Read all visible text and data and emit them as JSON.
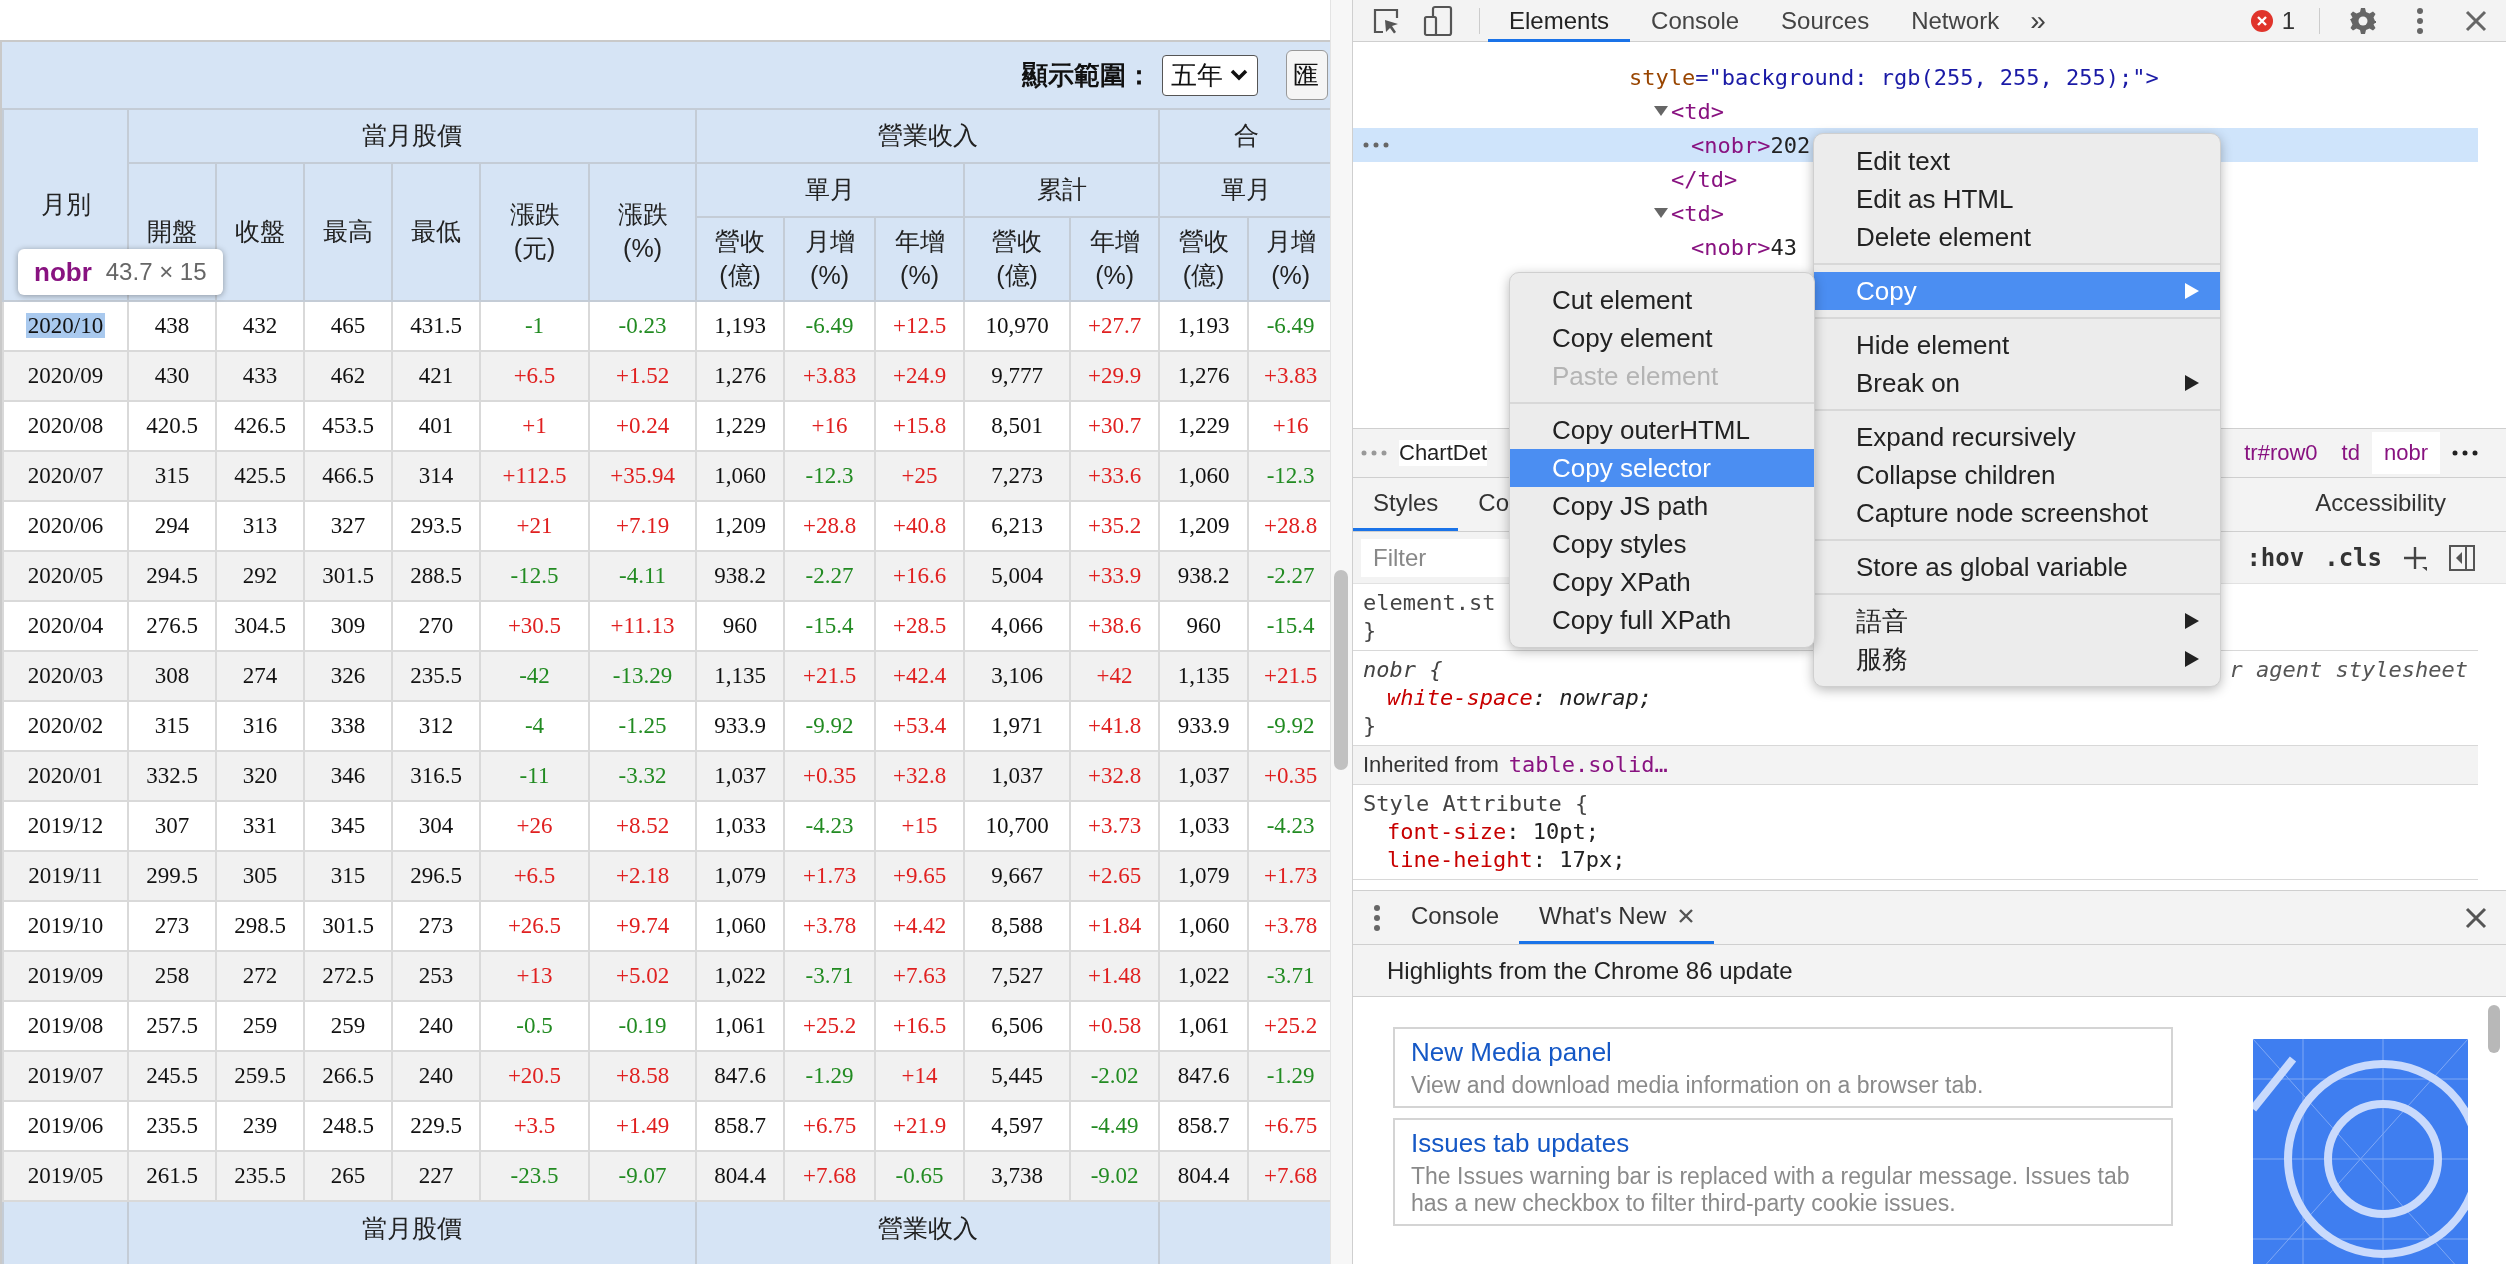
{
  "page": {
    "range_label": "顯示範圍：",
    "range_select": "五年",
    "cut_button": "匯",
    "tooltip": {
      "tag": "nobr",
      "size": "43.7 × 15"
    },
    "table": {
      "month_header": "月別",
      "groups": [
        {
          "label": "當月股價",
          "kind": "flat",
          "columns": [
            "開盤",
            "收盤",
            "最高",
            "最低",
            "漲跌 (元)",
            "漲跌 (%)"
          ]
        },
        {
          "label": "營業收入",
          "kind": "split",
          "subgroups": [
            {
              "label": "單月",
              "columns": [
                "營收 (億)",
                "月增 (%)",
                "年增 (%)"
              ]
            },
            {
              "label": "累計",
              "columns": [
                "營收 (億)",
                "年增 (%)"
              ]
            }
          ]
        },
        {
          "label": "合",
          "kind": "split",
          "subgroups": [
            {
              "label": "單月",
              "columns": [
                "營收 (億)",
                "月增 (%)"
              ]
            }
          ]
        }
      ],
      "rows": [
        {
          "highlighted": true,
          "cells": [
            {
              "text": "2020/10"
            },
            {
              "text": "438"
            },
            {
              "text": "432"
            },
            {
              "text": "465"
            },
            {
              "text": "431.5"
            },
            {
              "text": "-1",
              "rising": false
            },
            {
              "text": "-0.23",
              "rising": false
            },
            {
              "text": "1,193"
            },
            {
              "text": "-6.49",
              "rising": false
            },
            {
              "text": "+12.5",
              "rising": true
            },
            {
              "text": "10,970"
            },
            {
              "text": "+27.7",
              "rising": true
            },
            {
              "text": "1,193"
            },
            {
              "text": "-6.49",
              "rising": false
            }
          ]
        },
        {
          "highlighted": false,
          "cells": [
            {
              "text": "2020/09"
            },
            {
              "text": "430"
            },
            {
              "text": "433"
            },
            {
              "text": "462"
            },
            {
              "text": "421"
            },
            {
              "text": "+6.5",
              "rising": true
            },
            {
              "text": "+1.52",
              "rising": true
            },
            {
              "text": "1,276"
            },
            {
              "text": "+3.83",
              "rising": true
            },
            {
              "text": "+24.9",
              "rising": true
            },
            {
              "text": "9,777"
            },
            {
              "text": "+29.9",
              "rising": true
            },
            {
              "text": "1,276"
            },
            {
              "text": "+3.83",
              "rising": true
            }
          ]
        },
        {
          "highlighted": false,
          "cells": [
            {
              "text": "2020/08"
            },
            {
              "text": "420.5"
            },
            {
              "text": "426.5"
            },
            {
              "text": "453.5"
            },
            {
              "text": "401"
            },
            {
              "text": "+1",
              "rising": true
            },
            {
              "text": "+0.24",
              "rising": true
            },
            {
              "text": "1,229"
            },
            {
              "text": "+16",
              "rising": true
            },
            {
              "text": "+15.8",
              "rising": true
            },
            {
              "text": "8,501"
            },
            {
              "text": "+30.7",
              "rising": true
            },
            {
              "text": "1,229"
            },
            {
              "text": "+16",
              "rising": true
            }
          ]
        },
        {
          "highlighted": false,
          "cells": [
            {
              "text": "2020/07"
            },
            {
              "text": "315"
            },
            {
              "text": "425.5"
            },
            {
              "text": "466.5"
            },
            {
              "text": "314"
            },
            {
              "text": "+112.5",
              "rising": true
            },
            {
              "text": "+35.94",
              "rising": true
            },
            {
              "text": "1,060"
            },
            {
              "text": "-12.3",
              "rising": false
            },
            {
              "text": "+25",
              "rising": true
            },
            {
              "text": "7,273"
            },
            {
              "text": "+33.6",
              "rising": true
            },
            {
              "text": "1,060"
            },
            {
              "text": "-12.3",
              "rising": false
            }
          ]
        },
        {
          "highlighted": false,
          "cells": [
            {
              "text": "2020/06"
            },
            {
              "text": "294"
            },
            {
              "text": "313"
            },
            {
              "text": "327"
            },
            {
              "text": "293.5"
            },
            {
              "text": "+21",
              "rising": true
            },
            {
              "text": "+7.19",
              "rising": true
            },
            {
              "text": "1,209"
            },
            {
              "text": "+28.8",
              "rising": true
            },
            {
              "text": "+40.8",
              "rising": true
            },
            {
              "text": "6,213"
            },
            {
              "text": "+35.2",
              "rising": true
            },
            {
              "text": "1,209"
            },
            {
              "text": "+28.8",
              "rising": true
            }
          ]
        },
        {
          "highlighted": false,
          "cells": [
            {
              "text": "2020/05"
            },
            {
              "text": "294.5"
            },
            {
              "text": "292"
            },
            {
              "text": "301.5"
            },
            {
              "text": "288.5"
            },
            {
              "text": "-12.5",
              "rising": false
            },
            {
              "text": "-4.11",
              "rising": false
            },
            {
              "text": "938.2"
            },
            {
              "text": "-2.27",
              "rising": false
            },
            {
              "text": "+16.6",
              "rising": true
            },
            {
              "text": "5,004"
            },
            {
              "text": "+33.9",
              "rising": true
            },
            {
              "text": "938.2"
            },
            {
              "text": "-2.27",
              "rising": false
            }
          ]
        },
        {
          "highlighted": false,
          "cells": [
            {
              "text": "2020/04"
            },
            {
              "text": "276.5"
            },
            {
              "text": "304.5"
            },
            {
              "text": "309"
            },
            {
              "text": "270"
            },
            {
              "text": "+30.5",
              "rising": true
            },
            {
              "text": "+11.13",
              "rising": true
            },
            {
              "text": "960"
            },
            {
              "text": "-15.4",
              "rising": false
            },
            {
              "text": "+28.5",
              "rising": true
            },
            {
              "text": "4,066"
            },
            {
              "text": "+38.6",
              "rising": true
            },
            {
              "text": "960"
            },
            {
              "text": "-15.4",
              "rising": false
            }
          ]
        },
        {
          "highlighted": false,
          "cells": [
            {
              "text": "2020/03"
            },
            {
              "text": "308"
            },
            {
              "text": "274"
            },
            {
              "text": "326"
            },
            {
              "text": "235.5"
            },
            {
              "text": "-42",
              "rising": false
            },
            {
              "text": "-13.29",
              "rising": false
            },
            {
              "text": "1,135"
            },
            {
              "text": "+21.5",
              "rising": true
            },
            {
              "text": "+42.4",
              "rising": true
            },
            {
              "text": "3,106"
            },
            {
              "text": "+42",
              "rising": true
            },
            {
              "text": "1,135"
            },
            {
              "text": "+21.5",
              "rising": true
            }
          ]
        },
        {
          "highlighted": false,
          "cells": [
            {
              "text": "2020/02"
            },
            {
              "text": "315"
            },
            {
              "text": "316"
            },
            {
              "text": "338"
            },
            {
              "text": "312"
            },
            {
              "text": "-4",
              "rising": false
            },
            {
              "text": "-1.25",
              "rising": false
            },
            {
              "text": "933.9"
            },
            {
              "text": "-9.92",
              "rising": false
            },
            {
              "text": "+53.4",
              "rising": true
            },
            {
              "text": "1,971"
            },
            {
              "text": "+41.8",
              "rising": true
            },
            {
              "text": "933.9"
            },
            {
              "text": "-9.92",
              "rising": false
            }
          ]
        },
        {
          "highlighted": false,
          "cells": [
            {
              "text": "2020/01"
            },
            {
              "text": "332.5"
            },
            {
              "text": "320"
            },
            {
              "text": "346"
            },
            {
              "text": "316.5"
            },
            {
              "text": "-11",
              "rising": false
            },
            {
              "text": "-3.32",
              "rising": false
            },
            {
              "text": "1,037"
            },
            {
              "text": "+0.35",
              "rising": true
            },
            {
              "text": "+32.8",
              "rising": true
            },
            {
              "text": "1,037"
            },
            {
              "text": "+32.8",
              "rising": true
            },
            {
              "text": "1,037"
            },
            {
              "text": "+0.35",
              "rising": true
            }
          ]
        },
        {
          "highlighted": false,
          "cells": [
            {
              "text": "2019/12"
            },
            {
              "text": "307"
            },
            {
              "text": "331"
            },
            {
              "text": "345"
            },
            {
              "text": "304"
            },
            {
              "text": "+26",
              "rising": true
            },
            {
              "text": "+8.52",
              "rising": true
            },
            {
              "text": "1,033"
            },
            {
              "text": "-4.23",
              "rising": false
            },
            {
              "text": "+15",
              "rising": true
            },
            {
              "text": "10,700"
            },
            {
              "text": "+3.73",
              "rising": true
            },
            {
              "text": "1,033"
            },
            {
              "text": "-4.23",
              "rising": false
            }
          ]
        },
        {
          "highlighted": false,
          "cells": [
            {
              "text": "2019/11"
            },
            {
              "text": "299.5"
            },
            {
              "text": "305"
            },
            {
              "text": "315"
            },
            {
              "text": "296.5"
            },
            {
              "text": "+6.5",
              "rising": true
            },
            {
              "text": "+2.18",
              "rising": true
            },
            {
              "text": "1,079"
            },
            {
              "text": "+1.73",
              "rising": true
            },
            {
              "text": "+9.65",
              "rising": true
            },
            {
              "text": "9,667"
            },
            {
              "text": "+2.65",
              "rising": true
            },
            {
              "text": "1,079"
            },
            {
              "text": "+1.73",
              "rising": true
            }
          ]
        },
        {
          "highlighted": false,
          "cells": [
            {
              "text": "2019/10"
            },
            {
              "text": "273"
            },
            {
              "text": "298.5"
            },
            {
              "text": "301.5"
            },
            {
              "text": "273"
            },
            {
              "text": "+26.5",
              "rising": true
            },
            {
              "text": "+9.74",
              "rising": true
            },
            {
              "text": "1,060"
            },
            {
              "text": "+3.78",
              "rising": true
            },
            {
              "text": "+4.42",
              "rising": true
            },
            {
              "text": "8,588"
            },
            {
              "text": "+1.84",
              "rising": true
            },
            {
              "text": "1,060"
            },
            {
              "text": "+3.78",
              "rising": true
            }
          ]
        },
        {
          "highlighted": false,
          "cells": [
            {
              "text": "2019/09"
            },
            {
              "text": "258"
            },
            {
              "text": "272"
            },
            {
              "text": "272.5"
            },
            {
              "text": "253"
            },
            {
              "text": "+13",
              "rising": true
            },
            {
              "text": "+5.02",
              "rising": true
            },
            {
              "text": "1,022"
            },
            {
              "text": "-3.71",
              "rising": false
            },
            {
              "text": "+7.63",
              "rising": true
            },
            {
              "text": "7,527"
            },
            {
              "text": "+1.48",
              "rising": true
            },
            {
              "text": "1,022"
            },
            {
              "text": "-3.71",
              "rising": false
            }
          ]
        },
        {
          "highlighted": false,
          "cells": [
            {
              "text": "2019/08"
            },
            {
              "text": "257.5"
            },
            {
              "text": "259"
            },
            {
              "text": "259"
            },
            {
              "text": "240"
            },
            {
              "text": "-0.5",
              "rising": false
            },
            {
              "text": "-0.19",
              "rising": false
            },
            {
              "text": "1,061"
            },
            {
              "text": "+25.2",
              "rising": true
            },
            {
              "text": "+16.5",
              "rising": true
            },
            {
              "text": "6,506"
            },
            {
              "text": "+0.58",
              "rising": true
            },
            {
              "text": "1,061"
            },
            {
              "text": "+25.2",
              "rising": true
            }
          ]
        },
        {
          "highlighted": false,
          "cells": [
            {
              "text": "2019/07"
            },
            {
              "text": "245.5"
            },
            {
              "text": "259.5"
            },
            {
              "text": "266.5"
            },
            {
              "text": "240"
            },
            {
              "text": "+20.5",
              "rising": true
            },
            {
              "text": "+8.58",
              "rising": true
            },
            {
              "text": "847.6"
            },
            {
              "text": "-1.29",
              "rising": false
            },
            {
              "text": "+14",
              "rising": true
            },
            {
              "text": "5,445"
            },
            {
              "text": "-2.02",
              "rising": false
            },
            {
              "text": "847.6"
            },
            {
              "text": "-1.29",
              "rising": false
            }
          ]
        },
        {
          "highlighted": false,
          "cells": [
            {
              "text": "2019/06"
            },
            {
              "text": "235.5"
            },
            {
              "text": "239"
            },
            {
              "text": "248.5"
            },
            {
              "text": "229.5"
            },
            {
              "text": "+3.5",
              "rising": true
            },
            {
              "text": "+1.49",
              "rising": true
            },
            {
              "text": "858.7"
            },
            {
              "text": "+6.75",
              "rising": true
            },
            {
              "text": "+21.9",
              "rising": true
            },
            {
              "text": "4,597"
            },
            {
              "text": "-4.49",
              "rising": false
            },
            {
              "text": "858.7"
            },
            {
              "text": "+6.75",
              "rising": true
            }
          ]
        },
        {
          "highlighted": false,
          "cells": [
            {
              "text": "2019/05"
            },
            {
              "text": "261.5"
            },
            {
              "text": "235.5"
            },
            {
              "text": "265"
            },
            {
              "text": "227"
            },
            {
              "text": "-23.5",
              "rising": false
            },
            {
              "text": "-9.07",
              "rising": false
            },
            {
              "text": "804.4"
            },
            {
              "text": "+7.68",
              "rising": true
            },
            {
              "text": "-0.65",
              "rising": false
            },
            {
              "text": "3,738"
            },
            {
              "text": "-9.02",
              "rising": false
            },
            {
              "text": "804.4"
            },
            {
              "text": "+7.68",
              "rising": true
            }
          ]
        }
      ],
      "footer_groups": [
        "當月股價",
        "營業收入"
      ]
    }
  },
  "devtools": {
    "tabs": [
      {
        "label": "Elements",
        "selected": true
      },
      {
        "label": "Console",
        "selected": false
      },
      {
        "label": "Sources",
        "selected": false
      },
      {
        "label": "Network",
        "selected": false
      }
    ],
    "more_tabs": "»",
    "error_count": "1",
    "dom_tree": [
      {
        "kind": "attribute",
        "name": "style",
        "value": "=\"background: rgb(255, 255, 255);\">",
        "selected": false,
        "children": [
          {
            "kind": "element",
            "tag": "<td>",
            "expanded": true,
            "selected": false,
            "children": [
              {
                "kind": "element",
                "tag": "<nobr>",
                "text": "202",
                "selected": true
              }
            ]
          },
          {
            "kind": "element",
            "tag": "</td>",
            "selected": false
          },
          {
            "kind": "element",
            "tag": "<td>",
            "expanded": true,
            "selected": false,
            "children": [
              {
                "kind": "element",
                "tag": "<nobr>",
                "text": "43",
                "selected": false
              }
            ]
          }
        ]
      }
    ],
    "breadcrumbs": {
      "left": "ChartDet",
      "items": [
        {
          "label": "tr#row0",
          "selected": false
        },
        {
          "label": "td",
          "selected": false
        },
        {
          "label": "nobr",
          "selected": true
        }
      ]
    },
    "style_tabs": [
      {
        "label": "Styles",
        "selected": true
      },
      {
        "label": "Co",
        "selected": false
      },
      {
        "label": "Accessibility",
        "selected": false
      }
    ],
    "filter": {
      "placeholder": "Filter"
    },
    "hov": ":hov",
    "cls": ".cls",
    "rules": [
      {
        "kind": "element",
        "header": "element.st",
        "footer": "}"
      },
      {
        "kind": "agent",
        "header": "nobr {",
        "declarations": [
          {
            "name": "white-space",
            "value": ": nowrap;"
          }
        ],
        "footer": "}",
        "source": "r agent stylesheet"
      },
      {
        "kind": "inherited",
        "label": "Inherited from",
        "selector": "table.solid…"
      },
      {
        "kind": "attribute",
        "header": "Style Attribute {",
        "declarations": [
          {
            "name": "font-size",
            "value": ": 10pt;"
          },
          {
            "name": "line-height",
            "value": ": 17px;"
          }
        ]
      }
    ],
    "drawer": {
      "tabs": [
        {
          "label": "Console",
          "selected": false,
          "closable": false
        },
        {
          "label": "What's New",
          "selected": true,
          "closable": true
        }
      ],
      "banner": "Highlights from the Chrome 86 update",
      "cards": [
        {
          "title": "New Media panel",
          "description": "View and download media information on a browser tab."
        },
        {
          "title": "Issues tab updates",
          "description": "The Issues warning bar is replaced with a regular message. Issues tab has a new checkbox to filter third-party cookie issues."
        }
      ]
    },
    "context_menu": {
      "sections": [
        [
          {
            "label": "Edit text",
            "submenu": false,
            "highlighted": false
          },
          {
            "label": "Edit as HTML",
            "submenu": false,
            "highlighted": false
          },
          {
            "label": "Delete element",
            "submenu": false,
            "highlighted": false
          }
        ],
        [
          {
            "label": "Copy",
            "submenu": true,
            "highlighted": true
          }
        ],
        [
          {
            "label": "Hide element",
            "submenu": false,
            "highlighted": false
          },
          {
            "label": "Break on",
            "submenu": true,
            "highlighted": false
          }
        ],
        [
          {
            "label": "Expand recursively",
            "submenu": false,
            "highlighted": false
          },
          {
            "label": "Collapse children",
            "submenu": false,
            "highlighted": false
          },
          {
            "label": "Capture node screenshot",
            "submenu": false,
            "highlighted": false
          }
        ],
        [
          {
            "label": "Store as global variable",
            "submenu": false,
            "highlighted": false
          }
        ],
        [
          {
            "label": "語音",
            "submenu": true,
            "highlighted": false
          },
          {
            "label": "服務",
            "submenu": true,
            "highlighted": false
          }
        ]
      ]
    },
    "copy_submenu": {
      "sections": [
        [
          {
            "label": "Cut element",
            "disabled": false,
            "highlighted": false
          },
          {
            "label": "Copy element",
            "disabled": false,
            "highlighted": false
          },
          {
            "label": "Paste element",
            "disabled": true,
            "highlighted": false
          }
        ],
        [
          {
            "label": "Copy outerHTML",
            "disabled": false,
            "highlighted": false
          },
          {
            "label": "Copy selector",
            "disabled": false,
            "highlighted": true
          },
          {
            "label": "Copy JS path",
            "disabled": false,
            "highlighted": false
          },
          {
            "label": "Copy styles",
            "disabled": false,
            "highlighted": false
          },
          {
            "label": "Copy XPath",
            "disabled": false,
            "highlighted": false
          },
          {
            "label": "Copy full XPath",
            "disabled": false,
            "highlighted": false
          }
        ]
      ]
    }
  }
}
